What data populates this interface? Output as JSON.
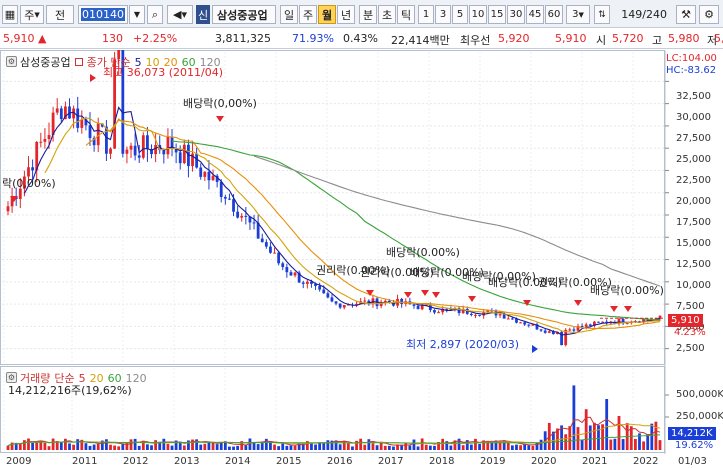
{
  "toolbar": {
    "market_select": "주",
    "previous_label": "전",
    "code": "010140",
    "stock_name": "삼성중공업",
    "credit_badge": "신",
    "periods": [
      "일",
      "주",
      "월",
      "년",
      "분",
      "초",
      "틱"
    ],
    "active_period": "월",
    "intervals": [
      "1",
      "3",
      "5",
      "10",
      "15",
      "30",
      "45",
      "60",
      "3"
    ],
    "page_counter": "149/240"
  },
  "infobar": {
    "price": "5,910 ▲",
    "change": "130",
    "change_pct": "+2.25%",
    "volume": "3,811,325",
    "ratio": "71.93%",
    "turnover": "0.43%",
    "amount": "22,414백만",
    "bid_label": "최우선",
    "bid_price": "5,920",
    "ask_price": "5,910",
    "open_label": "시",
    "open_price": "5,720",
    "high_label": "고",
    "high_price": "5,980",
    "low_label": "저",
    "low_price": "5,"
  },
  "price_panel": {
    "name": "삼성중공업",
    "ma_label": "종가 단순",
    "ma_periods": [
      "5",
      "10",
      "20",
      "60",
      "120"
    ],
    "lc_label": "LC:104.00",
    "hc_label": "HC:-83.62",
    "max_annotation": "최고 36,073 (2011/04)",
    "min_annotation": "최저 2,897 (2020/03)",
    "events": [
      "락(0,00%)",
      "배당락(0,00%)",
      "배당락(0.00%)",
      "권리락(0.00%)",
      "권리락(0.00%)",
      "배당락(0.00%)",
      "배당락(0.00%)",
      "배당락(0.00%)",
      "권리락(0.00%)",
      "배당락(0.00%)"
    ],
    "price_tag": "5,910",
    "pct_tag": "4.23%",
    "y_ticks": [
      "32,500",
      "30,000",
      "27,500",
      "25,000",
      "22,500",
      "20,000",
      "17,500",
      "15,000",
      "12,500",
      "10,000",
      "7,500",
      "5,000",
      "2,500"
    ]
  },
  "volume_panel": {
    "name": "거래량",
    "ma_label": "단순",
    "ma_periods": [
      "5",
      "20",
      "60",
      "120"
    ],
    "value_text": "14,212,216주(19,62%)",
    "y_ticks": [
      "500,000K",
      "250,000K"
    ],
    "volume_tag": "14,212K",
    "pct_tag": "19.62%"
  },
  "x_axis": [
    "2009",
    "2011",
    "2012",
    "2013",
    "2014",
    "2015",
    "2016",
    "2017",
    "2018",
    "2019",
    "2020",
    "2021",
    "2022",
    "01/03"
  ],
  "colors": {
    "up": "#e3262b",
    "down": "#1b3fd6",
    "ma5": "#1b1b9a",
    "ma10": "#d4a20a",
    "ma20": "#e88f0a",
    "ma60": "#3aa33a",
    "ma120": "#8c8c8c"
  },
  "chart_data": {
    "type": "candlestick",
    "series": [
      {
        "name": "5",
        "type": "line"
      },
      {
        "name": "10",
        "type": "line"
      },
      {
        "name": "20",
        "type": "line"
      },
      {
        "name": "60",
        "type": "line"
      },
      {
        "name": "120",
        "type": "line"
      }
    ],
    "x": [
      "2009",
      "2011",
      "2012",
      "2013",
      "2014",
      "2015",
      "2016",
      "2017",
      "2018",
      "2019",
      "2020",
      "2021",
      "2022"
    ],
    "close_approx": [
      18500,
      30000,
      24500,
      25500,
      20000,
      12000,
      7500,
      7800,
      6800,
      6500,
      4300,
      5500,
      5910
    ],
    "ylim": [
      1000,
      34000
    ],
    "max": {
      "value": 36073,
      "date": "2011/04"
    },
    "min": {
      "value": 2897,
      "date": "2020/03"
    }
  }
}
